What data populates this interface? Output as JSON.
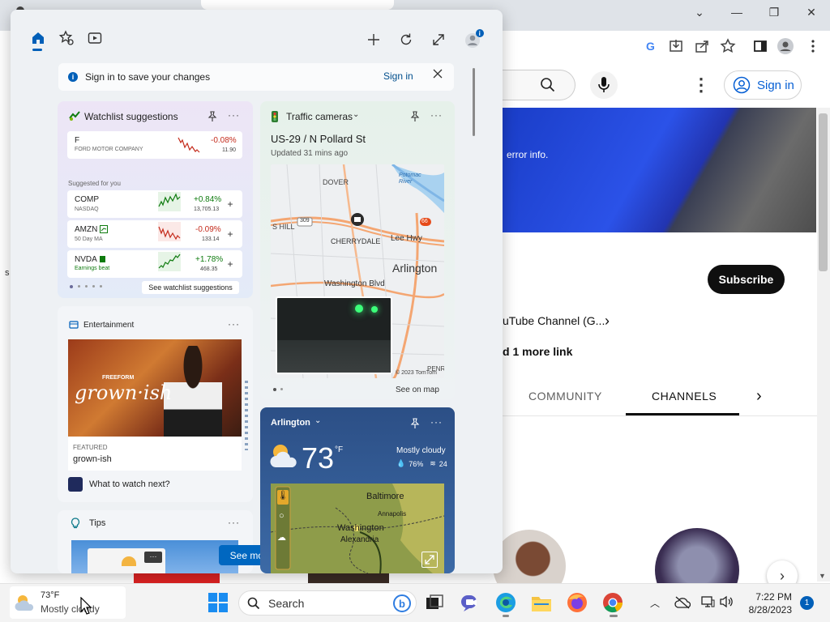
{
  "browser": {
    "window_controls": [
      "⌄",
      "—",
      "❐",
      "✕"
    ],
    "youtube": {
      "sign_in": "Sign in",
      "video_text": "error info.",
      "subscribe": "Subscribe",
      "channel_desc": "uTube Channel (G...",
      "more_links": "d 1 more link",
      "tabs": [
        "COMMUNITY",
        "CHANNELS"
      ],
      "active_tab": "CHANNELS"
    },
    "left_edge_char": "s"
  },
  "widgets": {
    "notice": {
      "text": "Sign in to save your changes",
      "signin": "Sign in"
    },
    "watchlist": {
      "title": "Watchlist suggestions",
      "top_stock": {
        "symbol": "F",
        "name": "FORD MOTOR COMPANY",
        "change": "-0.08%",
        "price": "11.90"
      },
      "suggested_label": "Suggested for you",
      "stocks": [
        {
          "symbol": "COMP",
          "sub": "NASDAQ",
          "change": "+0.84%",
          "price": "13,705.13"
        },
        {
          "symbol": "AMZN",
          "sub": "50 Day MA",
          "change": "-0.09%",
          "price": "133.14"
        },
        {
          "symbol": "NVDA",
          "sub": "Earnings beat",
          "change": "+1.78%",
          "price": "468.35"
        }
      ],
      "see_more": "See watchlist suggestions"
    },
    "entertainment": {
      "title": "Entertainment",
      "image_text": "grown·ish",
      "image_brand": "FREEFORM",
      "featured_label": "FEATURED",
      "featured_title": "grown-ish",
      "footer": "What to watch next?"
    },
    "tips": {
      "title": "Tips"
    },
    "see_more_button": "See more",
    "traffic": {
      "title": "Traffic cameras",
      "location": "US-29 / N Pollard St",
      "updated": "Updated 31 mins ago",
      "map_labels": {
        "dover": "DOVER",
        "cherrydale": "CHERRYDALE",
        "arlington": "Arlington",
        "washington_blvd": "Washington Blvd",
        "lee_hwy": "Lee Hwy",
        "potomac": "Potomac River",
        "copyright": "© 2023 TomTom",
        "penrose": "PENRO",
        "s_hill": "S HILL",
        "route309": "309",
        "route66": "66"
      },
      "see_on_map": "See on map"
    },
    "weather": {
      "location": "Arlington",
      "temp": "73",
      "unit": "°F",
      "condition": "Mostly cloudy",
      "humidity": "76%",
      "wind": "24",
      "map_labels": [
        "Baltimore",
        "Annapolis",
        "Washington",
        "Alexandria"
      ]
    }
  },
  "taskbar": {
    "weather_temp": "73°F",
    "weather_desc": "Mostly cloudy",
    "search_placeholder": "Search",
    "time": "7:22 PM",
    "date": "8/28/2023",
    "notification_count": "1"
  }
}
